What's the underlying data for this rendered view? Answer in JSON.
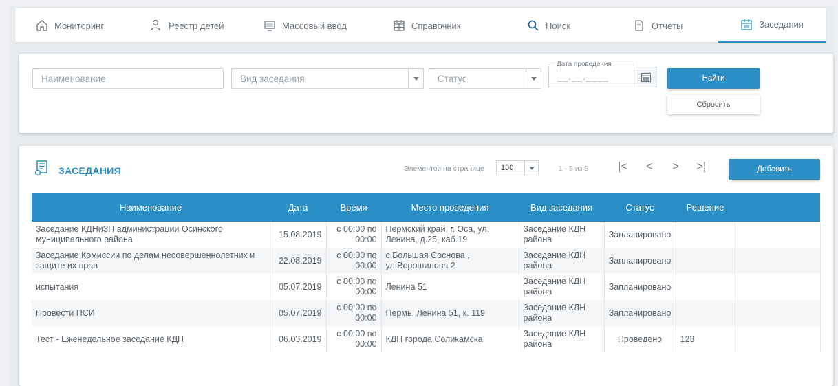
{
  "nav": {
    "items": [
      {
        "label": "Мониторинг",
        "icon": "home-icon"
      },
      {
        "label": "Реестр детей",
        "icon": "people-icon"
      },
      {
        "label": "Массовый ввод",
        "icon": "monitor-icon"
      },
      {
        "label": "Справочник",
        "icon": "calendar-grid-icon"
      },
      {
        "label": "Поиск",
        "icon": "search-icon"
      },
      {
        "label": "Отчёты",
        "icon": "document-icon"
      },
      {
        "label": "Заседания",
        "icon": "calendar-icon"
      }
    ],
    "active": "Заседания"
  },
  "filters": {
    "name_placeholder": "Наименование",
    "type_placeholder": "Вид заседания",
    "status_placeholder": "Статус",
    "date_label": "Дата проведения",
    "date_mask": "__.__.____",
    "find_label": "Найти",
    "reset_label": "Сбросить"
  },
  "table_section": {
    "title": "ЗАСЕДАНИЯ",
    "per_page_label": "Элементов на странице",
    "per_page_value": "100",
    "range_text": "1 - 5 из 5",
    "add_label": "Добавить",
    "columns": [
      "Наименование",
      "Дата",
      "Время",
      "Место проведения",
      "Вид заседания",
      "Статус",
      "Решение"
    ],
    "rows": [
      [
        "Заседание КДНиЗП администрации Осинского муниципального района",
        "15.08.2019",
        "с 00:00 по 00:00",
        "Пермский край, г. Оса, ул. Ленина, д.25, каб.19",
        "Заседание КДН района",
        "Запланировано",
        ""
      ],
      [
        "Заседание Комиссии по делам несовершеннолетних и защите их прав",
        "22.08.2019",
        "с 00:00 по 00:00",
        "с.Большая Соснова , ул.Ворошилова 2",
        "Заседание КДН района",
        "Запланировано",
        ""
      ],
      [
        "испытания",
        "05.07.2019",
        "с 00:00 по 00:00",
        "Ленина 51",
        "Заседание КДН района",
        "Запланировано",
        ""
      ],
      [
        "Провести ПСИ",
        "05.07.2019",
        "с 00:00 по 00:00",
        "Пермь, Ленина 51, к. 119",
        "Заседание КДН района",
        "Запланировано",
        ""
      ],
      [
        "Тест - Еженедельное заседание КДН",
        "06.03.2019",
        "с 00:00 по 00:00",
        "КДН города Соликамска",
        "Заседание КДН района",
        "Проведено",
        "123"
      ]
    ]
  },
  "colors": {
    "accent": "#2b8ec4"
  }
}
